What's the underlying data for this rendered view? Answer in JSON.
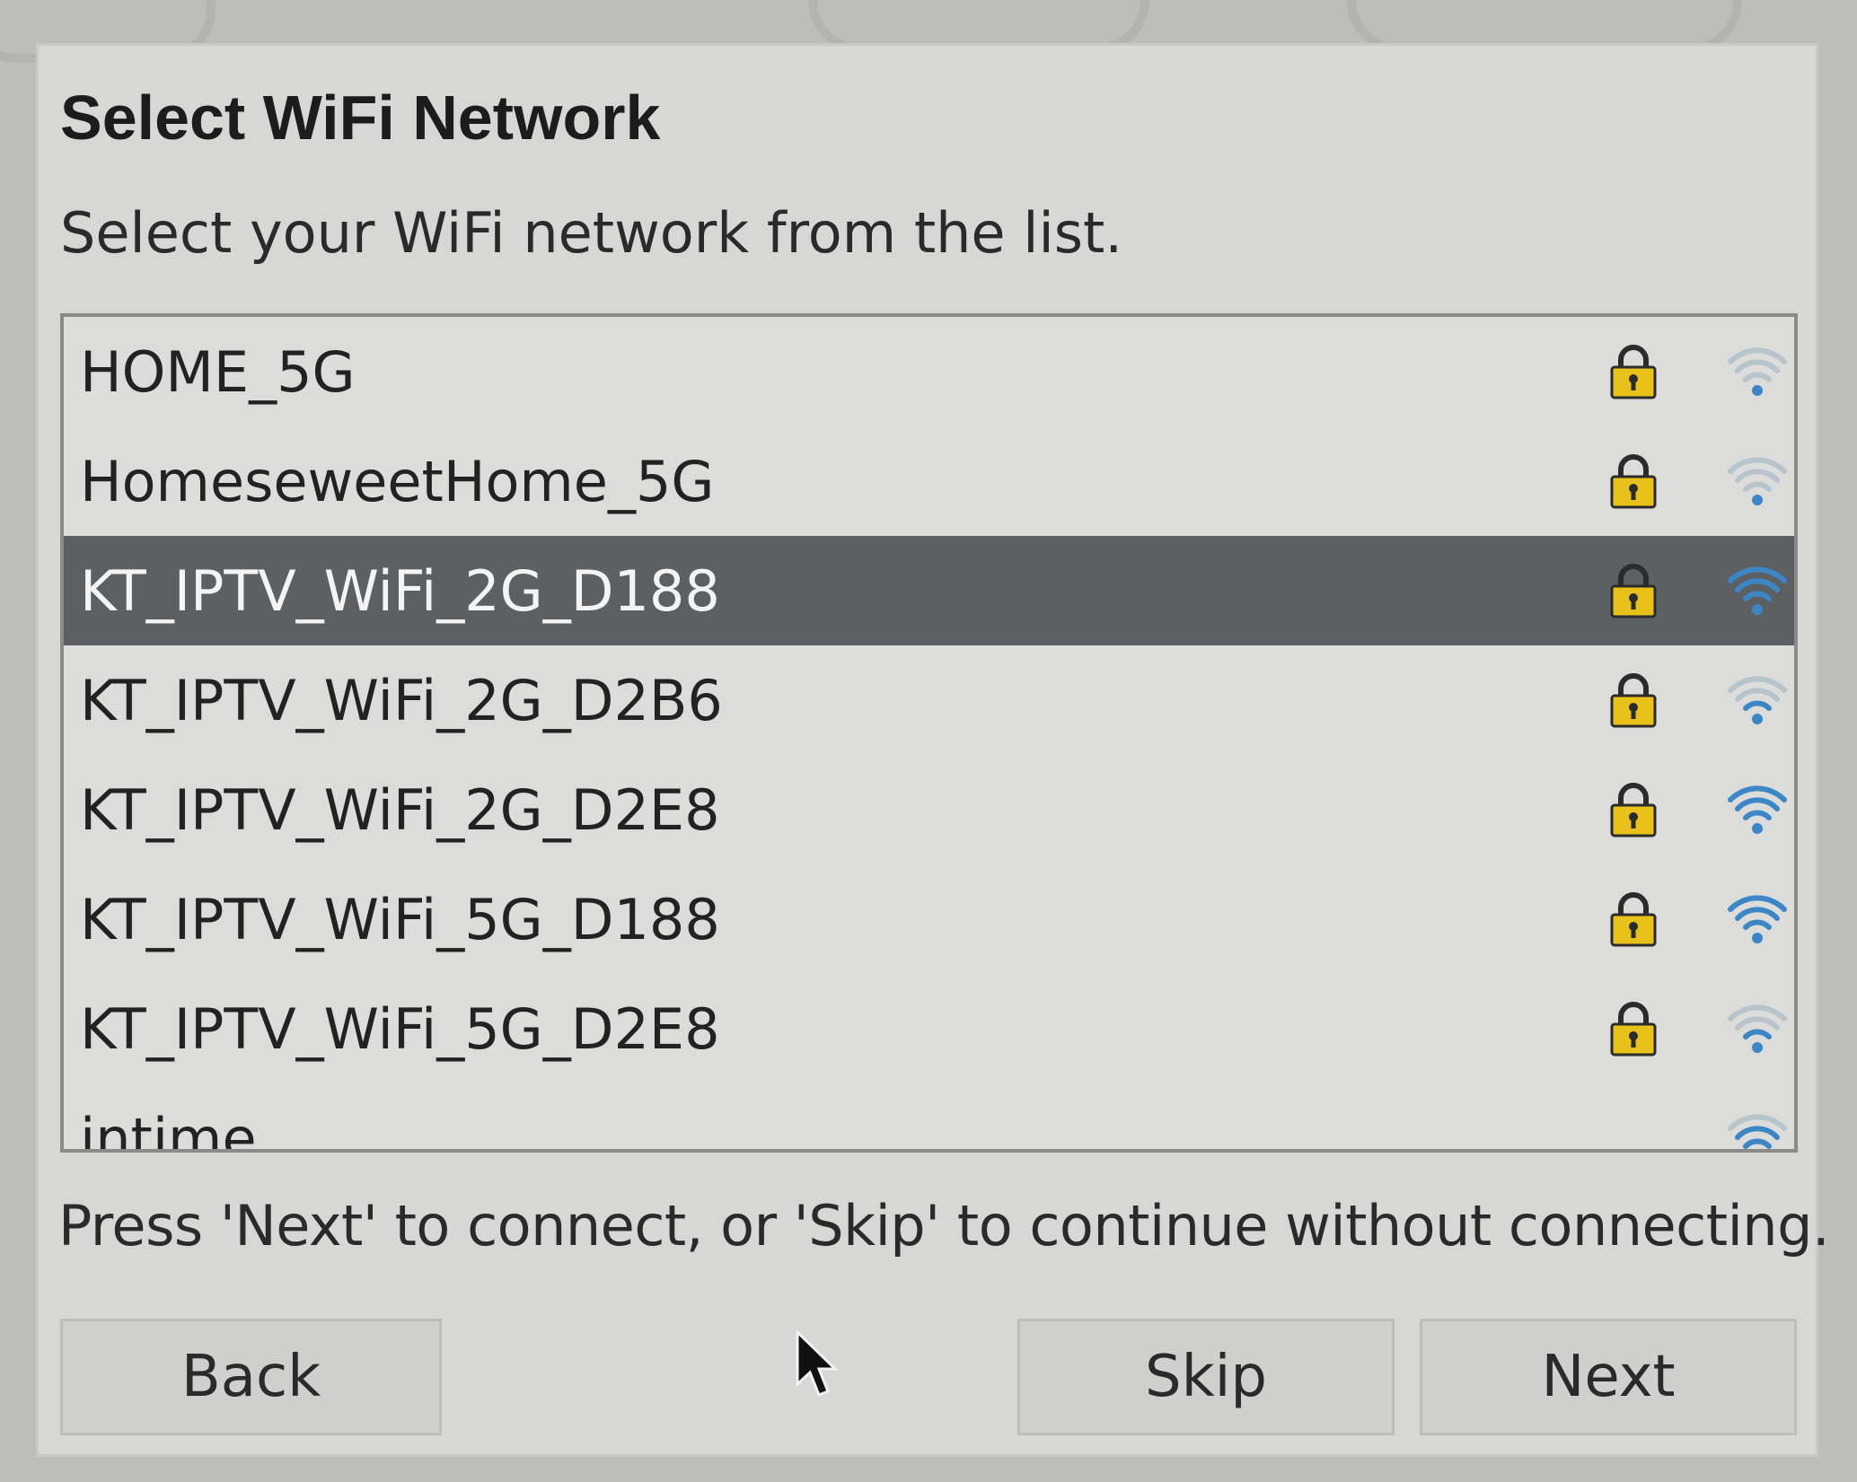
{
  "dialog": {
    "title": "Select WiFi Network",
    "subtitle": "Select your WiFi network from the list.",
    "hint": "Press 'Next' to connect, or 'Skip' to continue without connecting."
  },
  "networks": [
    {
      "ssid": "HOME_5G",
      "secured": true,
      "signal_bars": 1,
      "selected": false
    },
    {
      "ssid": "HomeseweetHome_5G",
      "secured": true,
      "signal_bars": 1,
      "selected": false
    },
    {
      "ssid": "KT_IPTV_WiFi_2G_D188",
      "secured": true,
      "signal_bars": 4,
      "selected": true
    },
    {
      "ssid": "KT_IPTV_WiFi_2G_D2B6",
      "secured": true,
      "signal_bars": 2,
      "selected": false
    },
    {
      "ssid": "KT_IPTV_WiFi_2G_D2E8",
      "secured": true,
      "signal_bars": 4,
      "selected": false
    },
    {
      "ssid": "KT_IPTV_WiFi_5G_D188",
      "secured": true,
      "signal_bars": 4,
      "selected": false
    },
    {
      "ssid": "KT_IPTV_WiFi_5G_D2E8",
      "secured": true,
      "signal_bars": 2,
      "selected": false
    },
    {
      "ssid": "intime",
      "secured": false,
      "signal_bars": 3,
      "selected": false
    }
  ],
  "buttons": {
    "back": "Back",
    "skip": "Skip",
    "next": "Next"
  },
  "colors": {
    "selection": "#5c6063",
    "signal_active": "#3d86c6",
    "signal_inactive": "#b8c4cc",
    "lock_body": "#e8c21a"
  },
  "icons": {
    "secured": "lock-icon",
    "signal": "wifi-signal-icon",
    "pointer": "mouse-pointer-icon"
  }
}
